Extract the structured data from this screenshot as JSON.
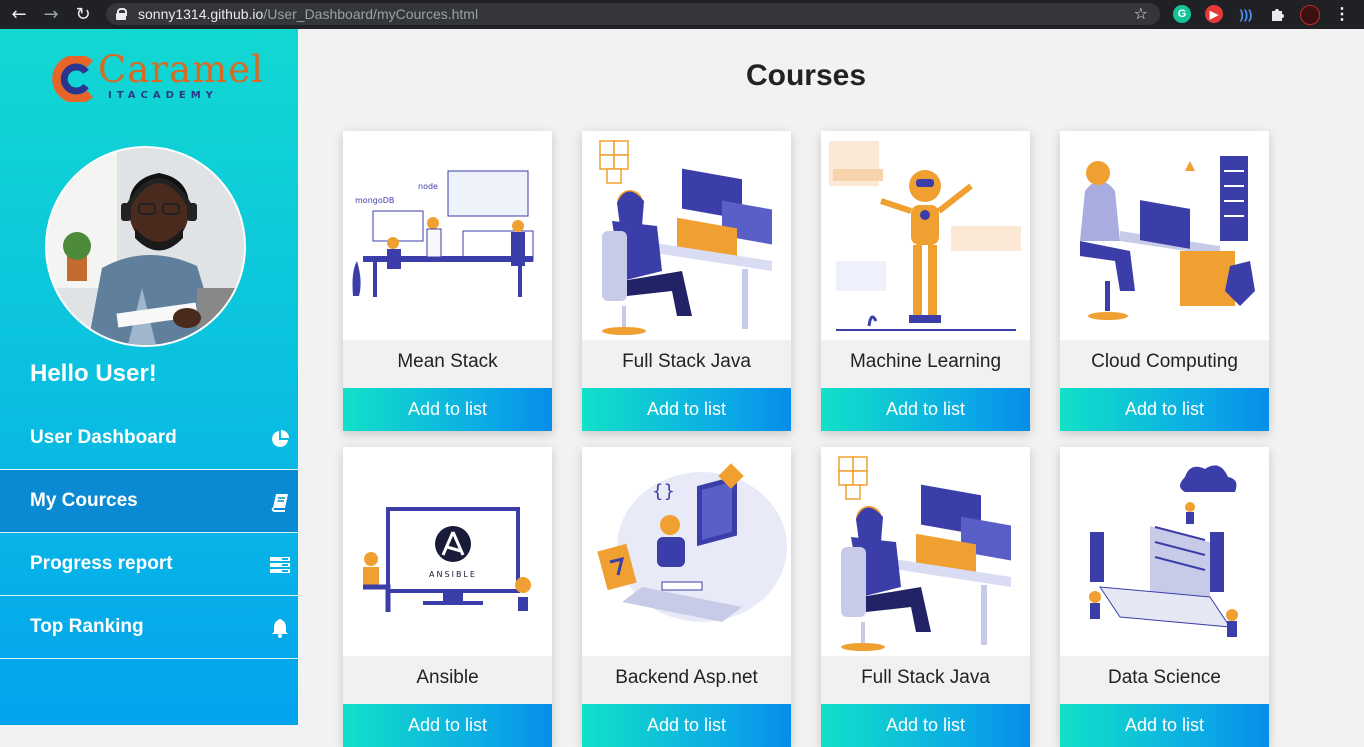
{
  "browser": {
    "url_host": "sonny1314.github.io",
    "url_path": "/User_Dashboard/myCources.html"
  },
  "sidebar": {
    "logo_title": "Caramel",
    "logo_subtitle": "ITACADEMY",
    "greeting": "Hello User!",
    "items": [
      {
        "label": "User Dashboard",
        "icon": "pie-chart-icon",
        "active": false
      },
      {
        "label": "My Cources",
        "icon": "book-icon",
        "active": true
      },
      {
        "label": "Progress report",
        "icon": "list-icon",
        "active": false
      },
      {
        "label": "Top Ranking",
        "icon": "bell-icon",
        "active": false
      }
    ]
  },
  "main": {
    "title": "Courses",
    "courses": [
      {
        "name": "Mean Stack",
        "button": "Add to list"
      },
      {
        "name": "Full Stack Java",
        "button": "Add to list"
      },
      {
        "name": "Machine Learning",
        "button": "Add to list"
      },
      {
        "name": "Cloud Computing",
        "button": "Add to list"
      },
      {
        "name": "Ansible",
        "button": "Add to list"
      },
      {
        "name": "Backend Asp.net",
        "button": "Add to list"
      },
      {
        "name": "Full Stack Java",
        "button": "Add to list"
      },
      {
        "name": "Data Science",
        "button": "Add to list"
      }
    ]
  },
  "colors": {
    "sidebar_top": "#12d8d2",
    "sidebar_bottom": "#03a3ee",
    "active_item": "#0a8ad2",
    "button_start": "#12e0c8",
    "button_end": "#078de9",
    "logo_orange": "#d96a22",
    "illustration_blue": "#3b3ea8",
    "illustration_orange": "#f0a030"
  }
}
